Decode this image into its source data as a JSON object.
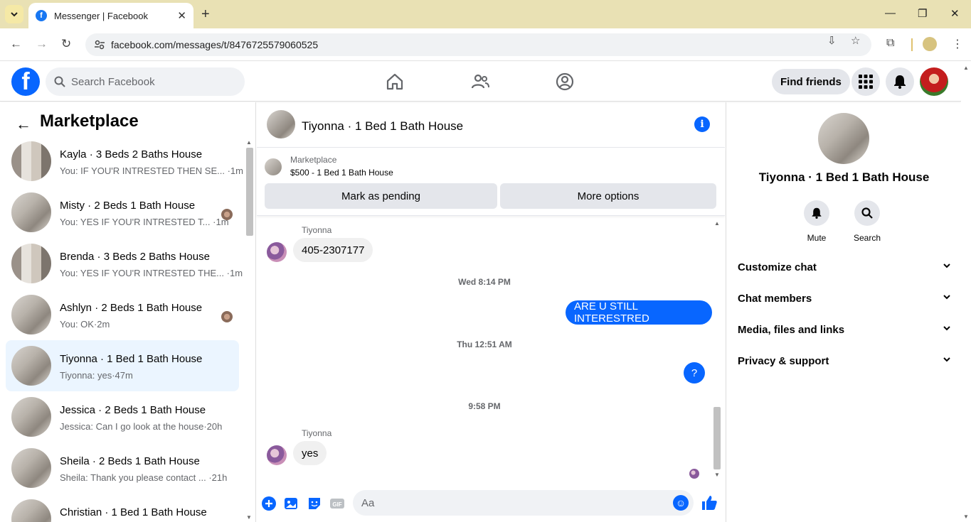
{
  "browser": {
    "tab_title": "Messenger | Facebook",
    "url": "facebook.com/messages/t/8476725579060525"
  },
  "fb_header": {
    "search_placeholder": "Search Facebook",
    "find_friends_label": "Find friends"
  },
  "left_pane": {
    "title": "Marketplace",
    "conversations": [
      {
        "name": "Kayla · 3 Beds 2 Baths House",
        "preview": "You: IF YOU'R INTRESTED THEN SE... ·1m",
        "seen": false,
        "active": false
      },
      {
        "name": "Misty · 2 Beds 1 Bath House",
        "preview": "You: YES IF YOU'R INTRESTED T... ·1m",
        "seen": true,
        "active": false
      },
      {
        "name": "Brenda · 3 Beds 2 Baths House",
        "preview": "You: YES IF YOU'R INTRESTED THE... ·1m",
        "seen": false,
        "active": false
      },
      {
        "name": "Ashlyn · 2 Beds 1 Bath House",
        "preview": "You: OK·2m",
        "seen": true,
        "active": false
      },
      {
        "name": "Tiyonna · 1 Bed 1 Bath House",
        "preview": "Tiyonna: yes·47m",
        "seen": false,
        "active": true
      },
      {
        "name": "Jessica · 2 Beds 1 Bath House",
        "preview": "Jessica: Can I go look at the house·20h",
        "seen": false,
        "active": false
      },
      {
        "name": "Sheila · 2 Beds 1 Bath House",
        "preview": "Sheila: Thank you please contact ... ·21h",
        "seen": false,
        "active": false
      },
      {
        "name": "Christian · 1 Bed 1 Bath House",
        "preview": "",
        "seen": false,
        "active": false
      }
    ]
  },
  "chat": {
    "title": "Tiyonna · 1 Bed 1 Bath House",
    "marketplace_label": "Marketplace",
    "listing": "$500 - 1 Bed 1 Bath House",
    "mark_pending_label": "Mark as pending",
    "more_options_label": "More options",
    "messages": {
      "sender_1": "Tiyonna",
      "msg_1": "405-2307177",
      "time_1": "Wed 8:14 PM",
      "msg_2": "ARE U STILL INTERESTRED",
      "time_2": "Thu 12:51 AM",
      "msg_3": "?",
      "time_3": "9:58 PM",
      "sender_2": "Tiyonna",
      "msg_4": "yes"
    },
    "composer_placeholder": "Aa"
  },
  "right_pane": {
    "name": "Tiyonna · 1 Bed 1 Bath House",
    "mute_label": "Mute",
    "search_label": "Search",
    "sections": [
      "Customize chat",
      "Chat members",
      "Media, files and links",
      "Privacy & support"
    ]
  },
  "colors": {
    "accent": "#0866ff",
    "tabbar": "#e9e1b4",
    "active_conversation": "#ebf5ff"
  }
}
